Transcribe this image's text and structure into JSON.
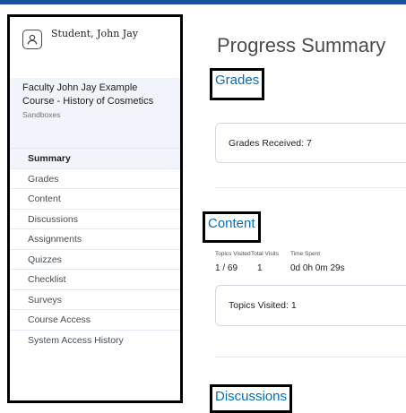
{
  "user": {
    "name": "Student, John Jay",
    "avatar_icon": "user-icon"
  },
  "course": {
    "title": "Faculty John Jay Example Course - History of Cosmetics",
    "org": "Sandboxes"
  },
  "nav": {
    "items": [
      {
        "label": "Summary",
        "active": true
      },
      {
        "label": "Grades"
      },
      {
        "label": "Content"
      },
      {
        "label": "Discussions"
      },
      {
        "label": "Assignments"
      },
      {
        "label": "Quizzes"
      },
      {
        "label": "Checklist"
      },
      {
        "label": "Surveys"
      },
      {
        "label": "Course Access"
      },
      {
        "label": "System Access History"
      }
    ]
  },
  "main": {
    "title": "Progress Summary",
    "grades": {
      "heading": "Grades",
      "card_text": "Grades Received: 7"
    },
    "content": {
      "heading": "Content",
      "stats": [
        {
          "label": "Topics Visited",
          "value": "1 / 69"
        },
        {
          "label": "Total Visits",
          "value": "1"
        },
        {
          "label": "Time Spent",
          "value": "0d 0h 0m 29s"
        }
      ],
      "card_text": "Topics Visited: 1"
    },
    "discussions": {
      "heading": "Discussions"
    }
  },
  "colors": {
    "accent_blue": "#006fbf",
    "top_bar": "#1c4f9c",
    "active_bg": "#f1f5fb"
  }
}
